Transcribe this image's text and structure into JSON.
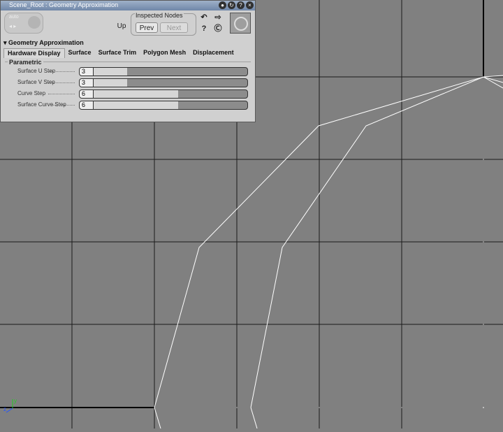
{
  "window": {
    "title": "Scene_Root : Geometry Approximation"
  },
  "toolbar": {
    "auto_label": "auto",
    "up_label": "Up",
    "inspected_label": "Inspected Nodes",
    "prev_label": "Prev",
    "next_label": "Next"
  },
  "section": {
    "title": "Geometry Approximation"
  },
  "tabs": [
    {
      "label": "Hardware Display"
    },
    {
      "label": "Surface"
    },
    {
      "label": "Surface Trim"
    },
    {
      "label": "Polygon Mesh"
    },
    {
      "label": "Displacement"
    }
  ],
  "parametric": {
    "group_label": "Parametric",
    "rows": [
      {
        "label": "Surface U Step",
        "value": "3",
        "fill": 0.22
      },
      {
        "label": "Surface V Step",
        "value": "3",
        "fill": 0.22
      },
      {
        "label": "Curve Step",
        "value": "6",
        "fill": 0.55
      },
      {
        "label": "Surface Curve Step",
        "value": "6",
        "fill": 0.55
      }
    ]
  },
  "colors": {
    "viewport_bg": "#808080",
    "grid": "#000000",
    "wire": "#ffffff",
    "panel_bg": "#d0d0d0",
    "title_bar": "#6f86a8"
  },
  "icons": {
    "titlebar": [
      "pin-icon",
      "refresh-icon",
      "help-icon",
      "close-icon"
    ],
    "toolbar": [
      "undo-icon",
      "link-icon",
      "question-icon",
      "cs-icon",
      "scene-object-icon"
    ]
  },
  "viewport": {
    "axis_labels": [
      "y",
      "z"
    ]
  }
}
